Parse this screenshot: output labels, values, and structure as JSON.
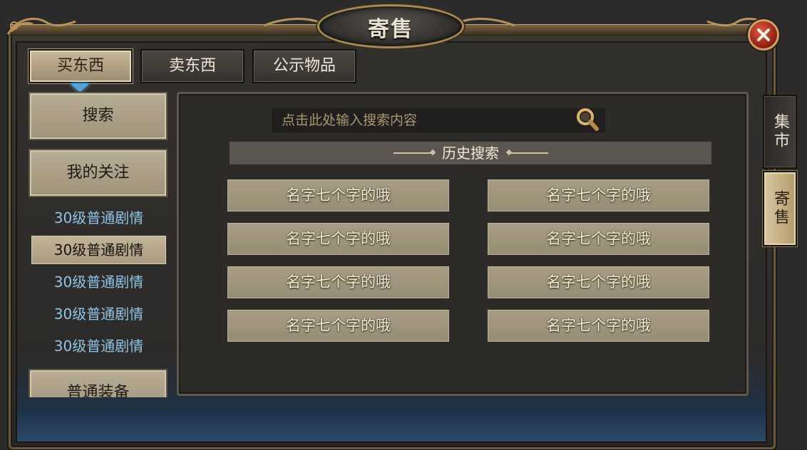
{
  "window": {
    "title": "寄售"
  },
  "tabs": [
    {
      "label": "买东西",
      "active": true
    },
    {
      "label": "卖东西",
      "active": false
    },
    {
      "label": "公示物品",
      "active": false
    }
  ],
  "sidebar": {
    "search_label": "搜索",
    "follow_label": "我的关注",
    "items": [
      {
        "label": "30级普通剧情",
        "active": false
      },
      {
        "label": "30级普通剧情",
        "active": true
      },
      {
        "label": "30级普通剧情",
        "active": false
      },
      {
        "label": "30级普通剧情",
        "active": false
      },
      {
        "label": "30级普通剧情",
        "active": false
      }
    ],
    "equipment_label": "普通装备"
  },
  "search": {
    "placeholder": "点击此处输入搜索内容",
    "value": ""
  },
  "history": {
    "title": "历史搜索",
    "items": [
      "名字七个字的哦",
      "名字七个字的哦",
      "名字七个字的哦",
      "名字七个字的哦",
      "名字七个字的哦",
      "名字七个字的哦",
      "名字七个字的哦",
      "名字七个字的哦"
    ]
  },
  "side_tabs": [
    {
      "label": "集市",
      "active": false
    },
    {
      "label": "寄售",
      "active": true
    }
  ],
  "icons": {
    "close": "close-icon",
    "search": "magnifier-icon"
  },
  "colors": {
    "accent_gold": "#a98a54",
    "list_text_blue": "#8fc6e8",
    "close_red": "#c0341e"
  }
}
